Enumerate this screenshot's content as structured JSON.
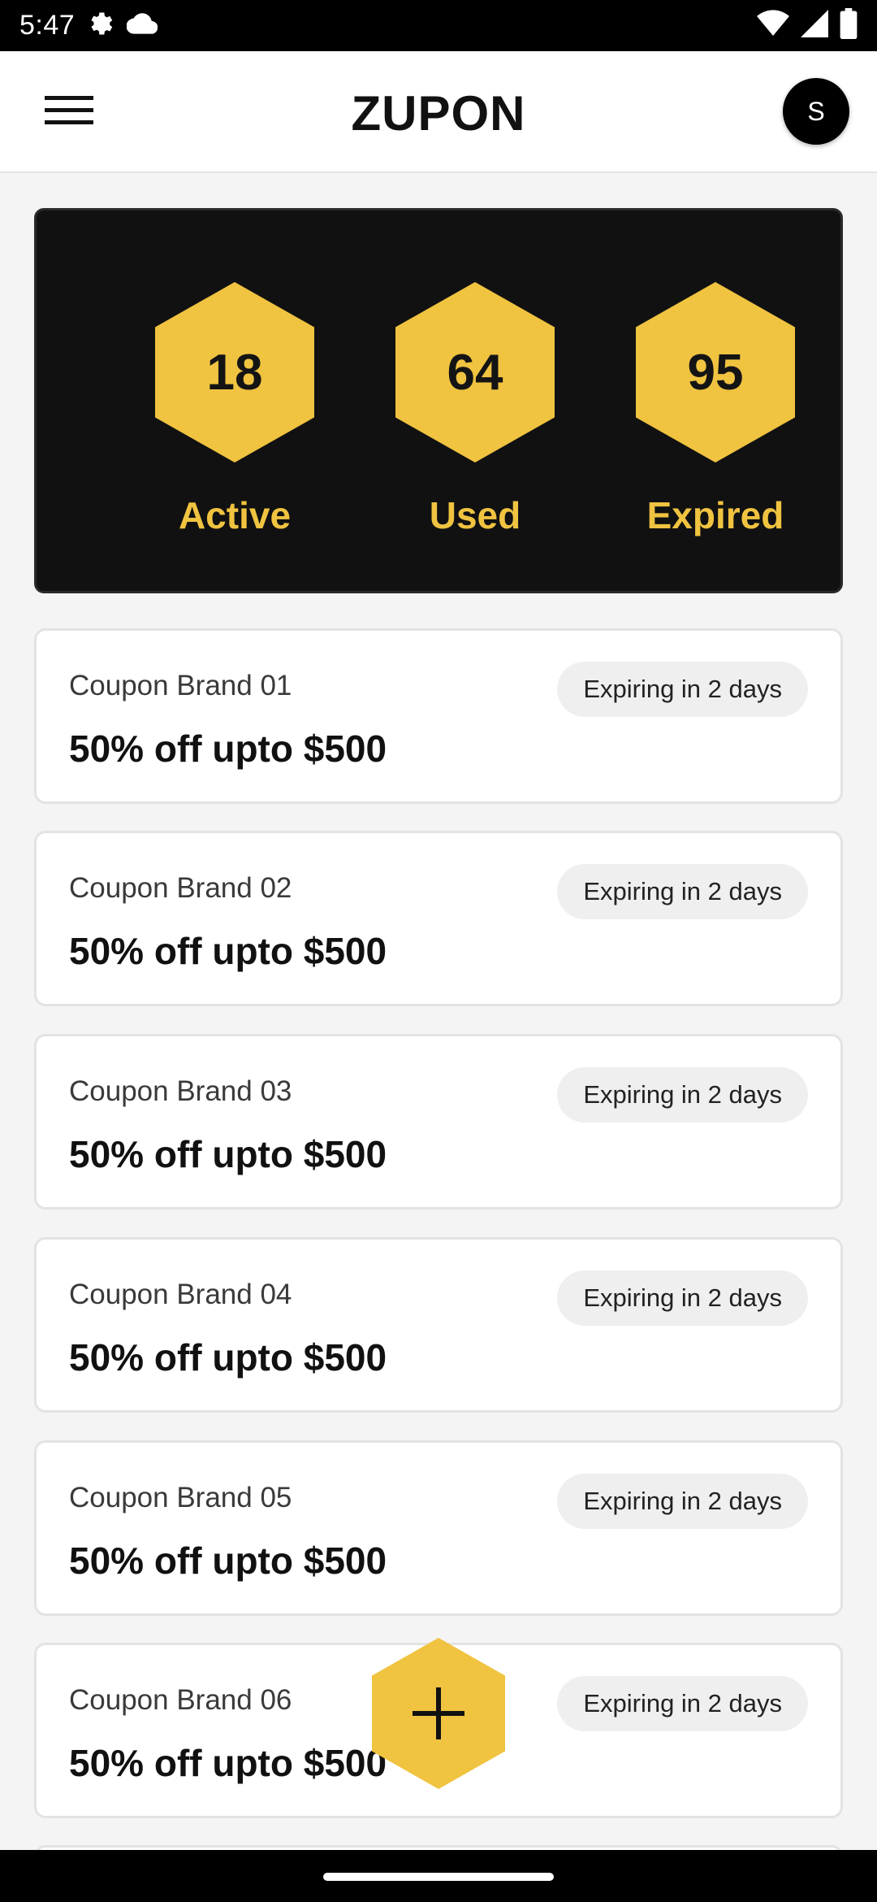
{
  "status_bar": {
    "time": "5:47",
    "icons_left": [
      "settings-gear-icon",
      "cloud-icon"
    ],
    "icons_right": [
      "wifi-icon",
      "cell-signal-icon",
      "battery-icon"
    ]
  },
  "app_bar": {
    "title": "ZUPON",
    "avatar_initial": "S"
  },
  "stats": [
    {
      "value": "18",
      "label": "Active"
    },
    {
      "value": "64",
      "label": "Used"
    },
    {
      "value": "95",
      "label": "Expired"
    }
  ],
  "coupons": [
    {
      "brand": "Coupon Brand 01",
      "offer": "50% off upto $500",
      "expiry": "Expiring in 2 days"
    },
    {
      "brand": "Coupon Brand 02",
      "offer": "50% off upto $500",
      "expiry": "Expiring in 2 days"
    },
    {
      "brand": "Coupon Brand 03",
      "offer": "50% off upto $500",
      "expiry": "Expiring in 2 days"
    },
    {
      "brand": "Coupon Brand 04",
      "offer": "50% off upto $500",
      "expiry": "Expiring in 2 days"
    },
    {
      "brand": "Coupon Brand 05",
      "offer": "50% off upto $500",
      "expiry": "Expiring in 2 days"
    },
    {
      "brand": "Coupon Brand 06",
      "offer": "50% off upto $500",
      "expiry": "Expiring in 2 days"
    }
  ],
  "fab": {
    "icon": "plus-icon"
  },
  "colors": {
    "accent": "#f0c340",
    "stats_background": "#111111",
    "background": "#f4f4f4"
  }
}
